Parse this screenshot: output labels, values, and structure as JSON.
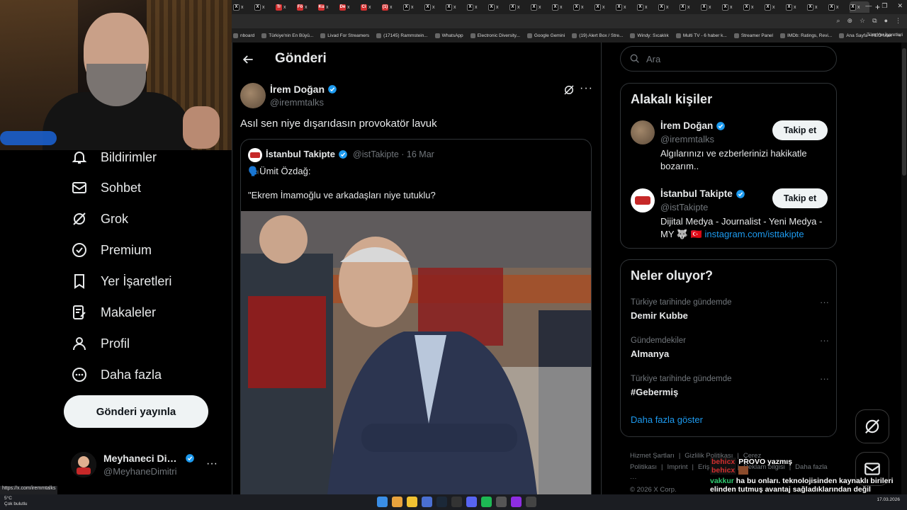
{
  "browser": {
    "tabs": [
      "X",
      "X",
      "Tr",
      "Fö",
      "Ku",
      "De",
      "Ci",
      "(1)",
      "X",
      "X",
      "X",
      "X",
      "X",
      "X",
      "X",
      "X",
      "X",
      "X",
      "X",
      "X",
      "X",
      "X",
      "X",
      "X",
      "X",
      "X",
      "X",
      "X",
      "X",
      "X"
    ],
    "tab_labels": [
      "x",
      "x",
      "x",
      "x",
      "x",
      "x",
      "x",
      "x",
      "x",
      "x",
      "x",
      "x",
      "x",
      "x",
      "x",
      "x",
      "x",
      "x",
      "x",
      "x",
      "x",
      "x",
      "x",
      "x",
      "x",
      "x",
      "x",
      "x",
      "x",
      "x"
    ],
    "bookmarks": [
      "nboard",
      "Türkiye'nin En Büyü...",
      "Livad For Streamers",
      "(17145) Rammstein...",
      "WhatsApp",
      "Electronic Diversity...",
      "Google Gemini",
      "(19) Alert Box / Stre...",
      "Windy: Sıcaklık",
      "Multi TV - 6 haber k...",
      "Streamer Panel",
      "IMDb: Ratings, Revi...",
      "Ana Sayfa • HBO Max"
    ],
    "bookmarks_more": "»",
    "all_bookmarks": "Tüm Yer İşaretleri",
    "status_url": "https://x.com/iremmtalks"
  },
  "nav": {
    "items": [
      {
        "label": "Bildirimler",
        "icon": "bell-icon"
      },
      {
        "label": "Sohbet",
        "icon": "mail-icon"
      },
      {
        "label": "Grok",
        "icon": "grok-icon"
      },
      {
        "label": "Premium",
        "icon": "verified-badge-icon"
      },
      {
        "label": "Yer İşaretleri",
        "icon": "bookmark-icon"
      },
      {
        "label": "Makaleler",
        "icon": "article-icon"
      },
      {
        "label": "Profil",
        "icon": "person-icon"
      },
      {
        "label": "Daha fazla",
        "icon": "more-circle-icon"
      }
    ],
    "post_button": "Gönderi yayınla",
    "account": {
      "name": "Meyhaneci Dimi...",
      "handle": "@MeyhaneDimitri",
      "more": "···"
    }
  },
  "post": {
    "header_title": "Gönderi",
    "author_name": "İrem Doğan",
    "author_handle": "@iremmtalks",
    "more": "···",
    "text": "Asıl sen niye dışarıdasın provokatör lavuk",
    "quote": {
      "author_name": "İstanbul Takipte",
      "meta": "@istTakipte · 16 Mar",
      "line1": "🗣️Ümit Özdağ:",
      "line2": "\"Ekrem İmamoğlu ve arkadaşları niye tutuklu?"
    }
  },
  "right": {
    "search_placeholder": "Ara",
    "related": {
      "title": "Alakalı kişiler",
      "people": [
        {
          "name": "İrem Doğan",
          "handle": "@iremmtalks",
          "bio": "Algılarınızı ve ezberlerinizi hakikatle bozarım..",
          "follow": "Takip et"
        },
        {
          "name": "İstanbul Takipte",
          "handle": "@istTakipte",
          "bio": "Dijital Medya - Journalist - Yeni Medya - MY 🐺 🇹🇷 ",
          "link": "instagram.com/isttakipte",
          "follow": "Takip et"
        }
      ]
    },
    "trends": {
      "title": "Neler oluyor?",
      "items": [
        {
          "context": "Türkiye tarihinde gündemde",
          "name": "Demir Kubbe",
          "more": "···"
        },
        {
          "context": "Gündemdekiler",
          "name": "Almanya",
          "more": "···"
        },
        {
          "context": "Türkiye tarihinde gündemde",
          "name": "#Gebermiş",
          "more": "···"
        }
      ],
      "show_more": "Daha fazla göster"
    },
    "footer": {
      "links": [
        "Hizmet Şartları",
        "|",
        "Gizlilik Politikası",
        "|",
        "Çerez Politikası",
        "|",
        "Imprint",
        "|",
        "Erişilebilirlik",
        "|",
        "Reklam bilgisi",
        "|",
        "Daha fazla ···"
      ],
      "copyright": "© 2026 X Corp."
    }
  },
  "chat": [
    {
      "user": "behicx",
      "msg": "PROVO yazmış"
    },
    {
      "user": "behicx",
      "msg": ""
    },
    {
      "user": "vakkur",
      "msg": "ha bu onları. teknolojisinden kaynaklı birileri elinden tutmuş avantaj sağladıklarından değil"
    }
  ],
  "taskbar": {
    "weather_temp": "5°C",
    "weather_desc": "Çok bulutlu",
    "clock": "17.03.2026"
  },
  "colors": {
    "accent": "#1d9bf0",
    "background": "#000000",
    "border": "#2f3336",
    "muted": "#71767b"
  }
}
